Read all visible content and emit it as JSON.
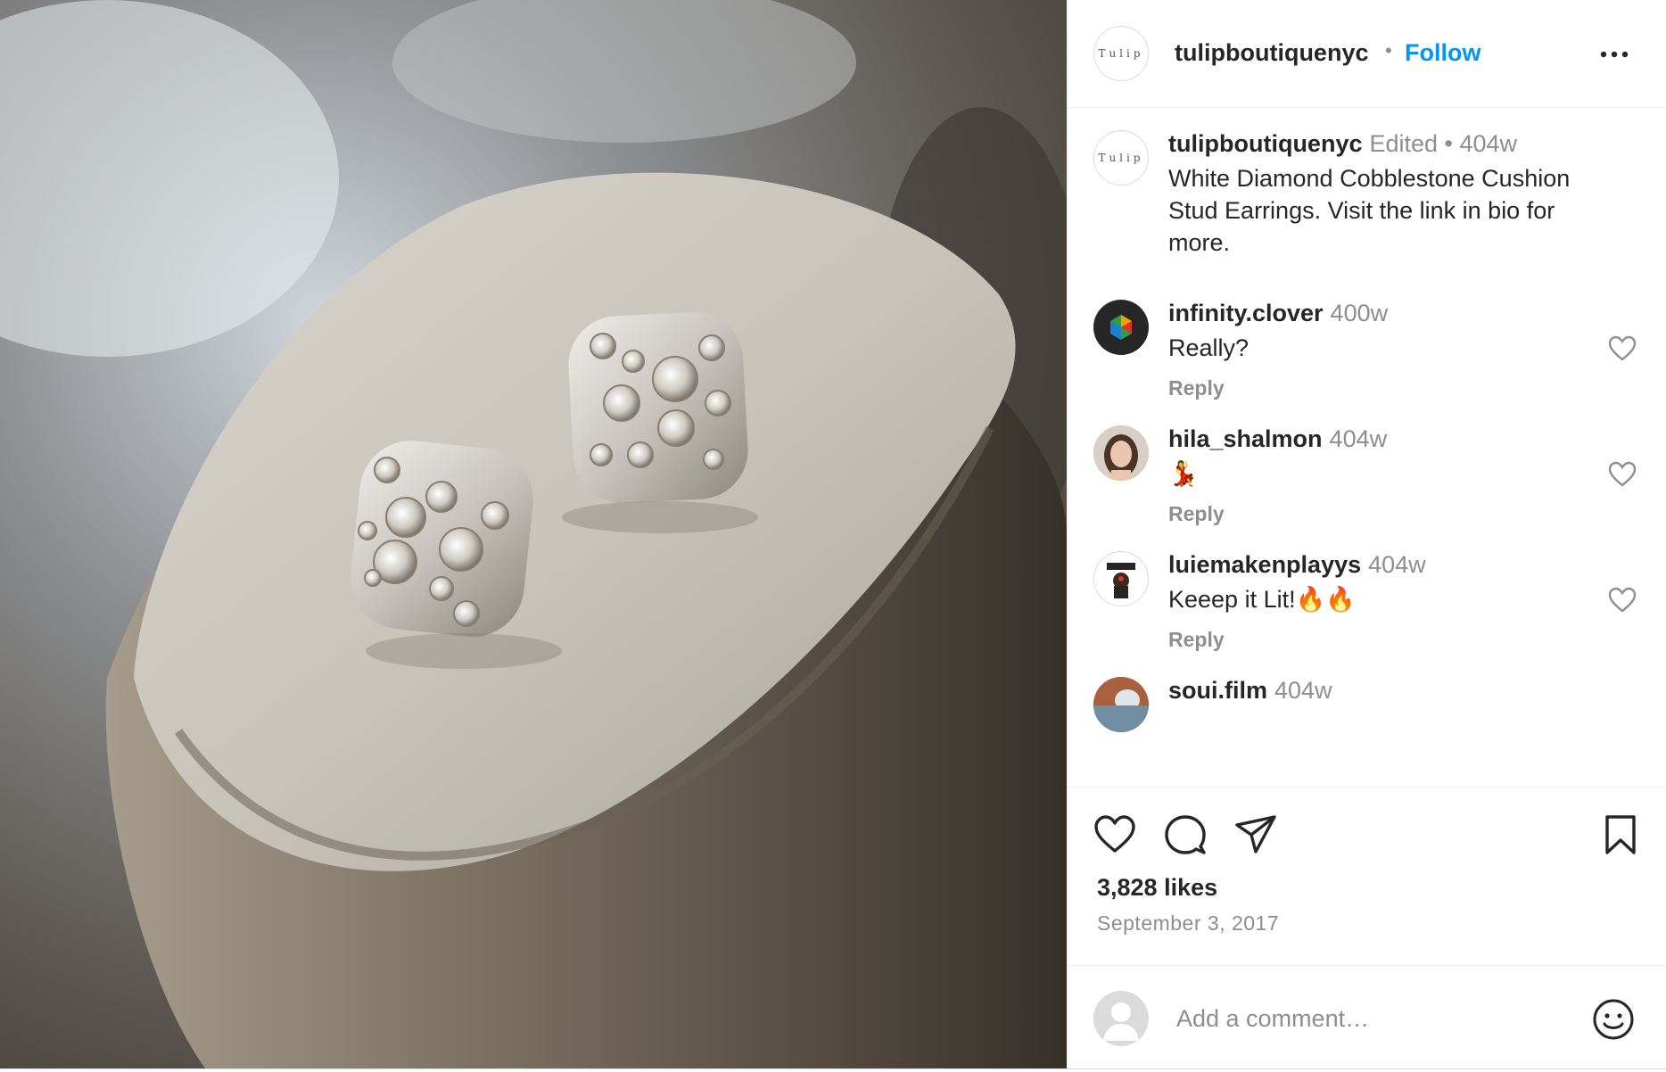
{
  "post": {
    "author": "tulipboutiquenyc",
    "author_avatar_text": "Tulip",
    "follow_label": "Follow",
    "separator": "•",
    "caption": {
      "user": "tulipboutiquenyc",
      "meta": "Edited •  404w",
      "text": "White Diamond Cobblestone Cushion Stud Earrings. Visit the link in bio for more."
    },
    "comments": [
      {
        "user": "infinity.clover",
        "time": "400w",
        "text": "Really?",
        "reply": "Reply",
        "avatar": "clover-logo"
      },
      {
        "user": "hila_shalmon",
        "time": "404w",
        "text": "💃",
        "reply": "Reply",
        "avatar": "profile-photo"
      },
      {
        "user": "luiemakenplayys",
        "time": "404w",
        "text": "Keeep it Lit!🔥🔥",
        "reply": "Reply",
        "avatar": "stormie-logo"
      },
      {
        "user": "soui.film",
        "time": "404w",
        "text": "",
        "reply": "",
        "avatar": "profile-photo"
      }
    ],
    "likes": "3,828 likes",
    "date": "September 3, 2017",
    "add_comment_placeholder": "Add a comment…",
    "icons": [
      "more-icon",
      "heart-icon",
      "comment-icon",
      "share-icon",
      "bookmark-icon",
      "emoji-icon"
    ],
    "colors": {
      "accent": "#0095f6",
      "muted": "#8e8e8e",
      "text": "#262626",
      "border": "#efefef"
    }
  }
}
